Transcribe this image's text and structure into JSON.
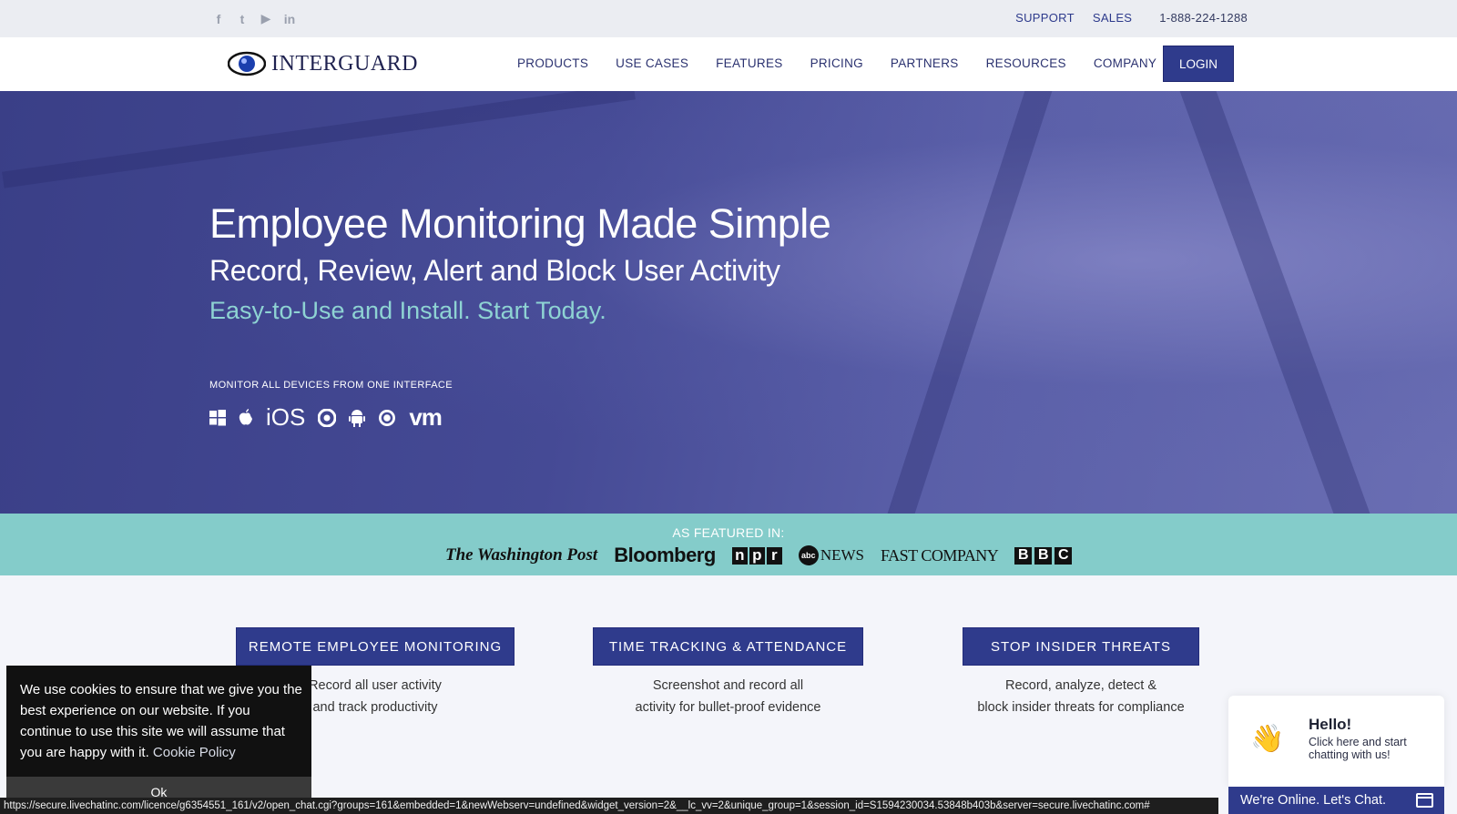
{
  "topbar": {
    "social": [
      "f",
      "t",
      "▶",
      "in"
    ],
    "support": "SUPPORT",
    "sales": "SALES",
    "phone": "1-888-224-1288"
  },
  "nav": {
    "logo_text": "INTERGUARD",
    "items": [
      "PRODUCTS",
      "USE CASES",
      "FEATURES",
      "PRICING",
      "PARTNERS",
      "RESOURCES",
      "COMPANY"
    ],
    "login": "LOGIN"
  },
  "hero": {
    "title": "Employee Monitoring Made Simple",
    "subtitle": "Record, Review, Alert and Block User Activity",
    "tagline": "Easy-to-Use and Install. Start Today.",
    "monitor_label": "MONITOR ALL DEVICES FROM ONE INTERFACE",
    "devices": {
      "ios": "iOS",
      "vm": "vm"
    }
  },
  "featured": {
    "label": "AS FEATURED IN:",
    "wp": "The Washington Post",
    "bloomberg": "Bloomberg",
    "npr": [
      "n",
      "p",
      "r"
    ],
    "abc": "abc",
    "abc_news": "NEWS",
    "fastcompany": "FAST COMPANY",
    "bbc": [
      "B",
      "B",
      "C"
    ]
  },
  "features": [
    {
      "title": "REMOTE EMPLOYEE MONITORING",
      "line1": "Record all user activity",
      "line2": "and track productivity"
    },
    {
      "title": "TIME TRACKING & ATTENDANCE",
      "line1": "Screenshot and record all",
      "line2": "activity for bullet-proof evidence"
    },
    {
      "title": "STOP INSIDER THREATS",
      "line1": "Record, analyze, detect &",
      "line2": "block insider threats for compliance"
    }
  ],
  "cookie": {
    "text": "We use cookies to ensure that we give you the best experience on our website. If you continue to use this site we will assume that you are happy with it.",
    "link": "Cookie Policy",
    "ok": "Ok"
  },
  "statusbar": {
    "url": "https://secure.livechatinc.com/licence/g6354551_161/v2/open_chat.cgi?groups=161&embedded=1&newWebserv=undefined&widget_version=2&__lc_vv=2&unique_group=1&session_id=S1594230034.53848b403b&server=secure.livechatinc.com#"
  },
  "chat": {
    "hello": "Hello!",
    "sub": "Click here and start chatting with us!",
    "bar": "We're Online. Let's Chat."
  },
  "colors": {
    "primary": "#2f3b8c",
    "teal": "#84ccca",
    "hero_tagline": "#8ed3d3"
  }
}
